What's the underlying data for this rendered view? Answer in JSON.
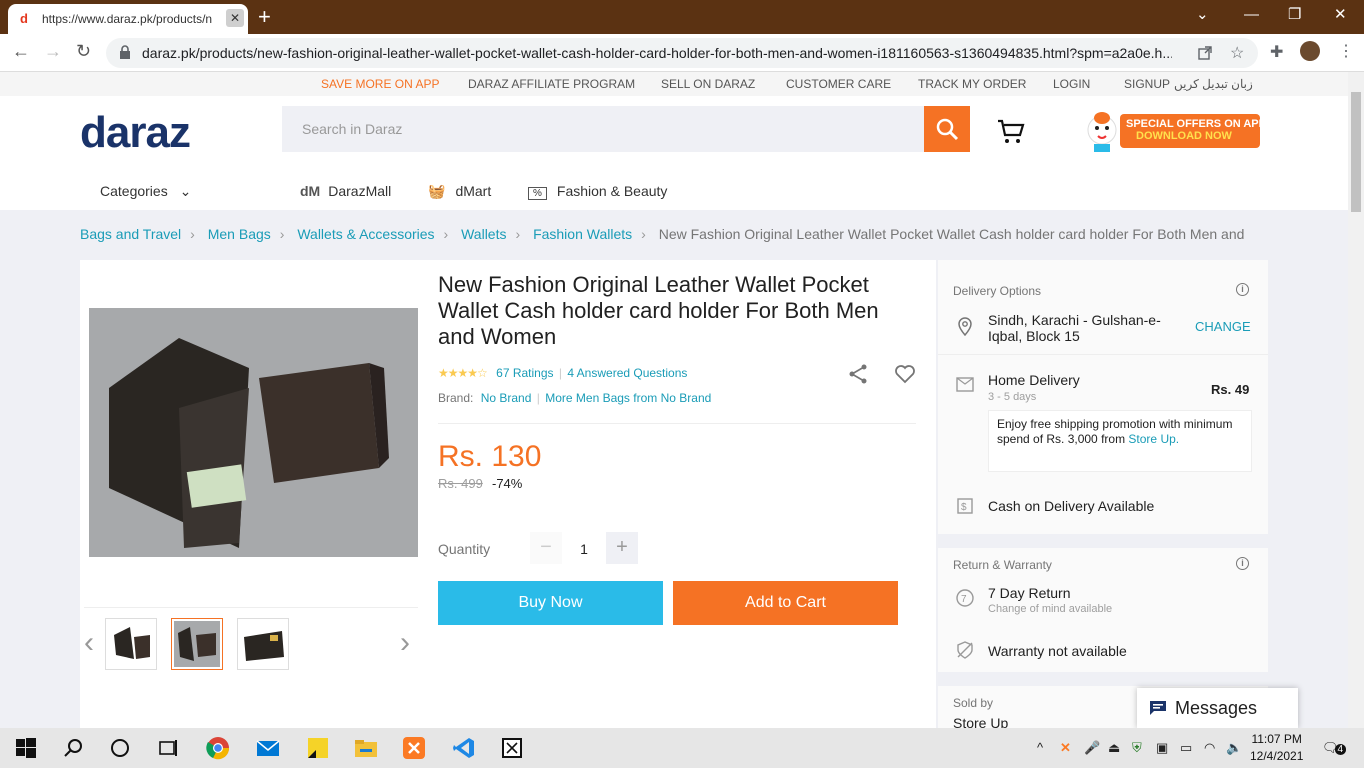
{
  "browser": {
    "tab_title": "https://www.daraz.pk/products/n",
    "tab_favicon": "d",
    "close_glyph": "✕",
    "new_tab": "+",
    "url": "daraz.pk/products/new-fashion-original-leather-wallet-pocket-wallet-cash-holder-card-holder-for-both-men-and-women-i181160563-s1360494835.html?spm=a2a0e.h..."
  },
  "top_nav": {
    "save_more": "SAVE MORE ON APP",
    "affiliate": "DARAZ AFFILIATE PROGRAM",
    "sell": "SELL ON DARAZ",
    "care": "CUSTOMER CARE",
    "track": "TRACK MY ORDER",
    "login": "LOGIN",
    "signup": "SIGNUP",
    "language": "زبان تبدیل کریں"
  },
  "header": {
    "logo": "daraz",
    "search_placeholder": "Search in Daraz",
    "promo_line1": "SPECIAL OFFERS ON APP",
    "promo_line2": "DOWNLOAD NOW"
  },
  "category_nav": {
    "categories": "Categories",
    "mall": "DarazMall",
    "dmart": "dMart",
    "beauty": "Fashion & Beauty"
  },
  "breadcrumb": [
    "Bags and Travel",
    "Men Bags",
    "Wallets & Accessories",
    "Wallets",
    "Fashion Wallets",
    "New Fashion Original Leather Wallet Pocket Wallet Cash holder card holder For Both Men and"
  ],
  "product": {
    "title": "New Fashion Original Leather Wallet Pocket Wallet Cash holder card holder For Both Men and Women",
    "stars": "★★★★☆",
    "ratings": "67 Ratings",
    "questions": "4 Answered Questions",
    "brand_label": "Brand:",
    "brand": "No Brand",
    "more_from": "More Men Bags from No Brand",
    "price": "Rs. 130",
    "old_price": "Rs. 499",
    "discount": "-74%",
    "quantity_label": "Quantity",
    "quantity": "1",
    "minus": "−",
    "plus": "+",
    "buy_now": "Buy Now",
    "add_to_cart": "Add to Cart",
    "prev": "‹",
    "next": "›"
  },
  "delivery": {
    "heading": "Delivery Options",
    "address_line1": "Sindh, Karachi - Gulshan-e-",
    "address_line2": "Iqbal, Block 15",
    "change": "CHANGE",
    "home_delivery": "Home Delivery",
    "days": "3 - 5 days",
    "fee": "Rs. 49",
    "promo_text": "Enjoy free shipping promotion with minimum spend of Rs. 3,000 from",
    "promo_link": "Store Up.",
    "cod": "Cash on Delivery Available",
    "info": "i"
  },
  "warranty": {
    "heading": "Return & Warranty",
    "return": "7 Day Return",
    "return_sub": "Change of mind available",
    "warranty": "Warranty not available"
  },
  "seller": {
    "sold_by": "Sold by",
    "name": "Store Up"
  },
  "messages": "Messages",
  "taskbar": {
    "time": "11:07 PM",
    "date": "12/4/2021",
    "notifications": "4",
    "caret": "^"
  }
}
